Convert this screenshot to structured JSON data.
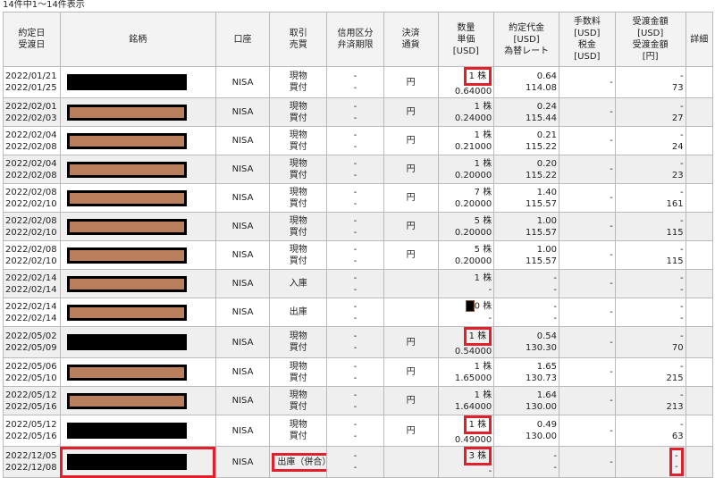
{
  "caption": "14件中1～14件表示",
  "headers": {
    "date": [
      "約定日",
      "受渡日"
    ],
    "stock": [
      "銘柄"
    ],
    "account": [
      "口座"
    ],
    "trade": [
      "取引",
      "売買"
    ],
    "credit": [
      "信用区分",
      "弁済期限"
    ],
    "settle": [
      "決済",
      "通貨"
    ],
    "qty": [
      "数量",
      "単価",
      "[USD]"
    ],
    "amount": [
      "約定代金",
      "[USD]",
      "為替レート"
    ],
    "fee": [
      "手数料",
      "[USD]",
      "税金",
      "[USD]"
    ],
    "recv": [
      "受渡金額",
      "[USD]",
      "受渡金額",
      "[円]"
    ],
    "detail": [
      "詳細"
    ]
  },
  "rows": [
    {
      "d1": "2022/01/21",
      "d2": "2022/01/25",
      "redact": "black",
      "acct": "NISA",
      "t1": "現物",
      "t2": "買付",
      "cr1": "-",
      "cr2": "-",
      "cur": "円",
      "q1": "1 株",
      "q2": "0.64000",
      "a1": "0.64",
      "a2": "114.08",
      "f1": "-",
      "f2": "",
      "r1": "-",
      "r2": "73",
      "hl_qty": true
    },
    {
      "d1": "2022/02/01",
      "d2": "2022/02/03",
      "redact": "brown",
      "acct": "NISA",
      "t1": "現物",
      "t2": "買付",
      "cr1": "-",
      "cr2": "-",
      "cur": "円",
      "q1": "1 株",
      "q2": "0.24000",
      "a1": "0.24",
      "a2": "115.44",
      "f1": "-",
      "f2": "",
      "r1": "-",
      "r2": "27"
    },
    {
      "d1": "2022/02/04",
      "d2": "2022/02/08",
      "redact": "brown",
      "acct": "NISA",
      "t1": "現物",
      "t2": "買付",
      "cr1": "-",
      "cr2": "-",
      "cur": "円",
      "q1": "1 株",
      "q2": "0.21000",
      "a1": "0.21",
      "a2": "115.22",
      "f1": "-",
      "f2": "",
      "r1": "-",
      "r2": "24"
    },
    {
      "d1": "2022/02/04",
      "d2": "2022/02/08",
      "redact": "brown",
      "acct": "NISA",
      "t1": "現物",
      "t2": "買付",
      "cr1": "-",
      "cr2": "-",
      "cur": "円",
      "q1": "1 株",
      "q2": "0.20000",
      "a1": "0.20",
      "a2": "115.22",
      "f1": "-",
      "f2": "",
      "r1": "-",
      "r2": "23"
    },
    {
      "d1": "2022/02/08",
      "d2": "2022/02/10",
      "redact": "brown",
      "acct": "NISA",
      "t1": "現物",
      "t2": "買付",
      "cr1": "-",
      "cr2": "-",
      "cur": "円",
      "q1": "7 株",
      "q2": "0.20000",
      "a1": "1.40",
      "a2": "115.57",
      "f1": "-",
      "f2": "",
      "r1": "-",
      "r2": "161"
    },
    {
      "d1": "2022/02/08",
      "d2": "2022/02/10",
      "redact": "brown",
      "acct": "NISA",
      "t1": "現物",
      "t2": "買付",
      "cr1": "-",
      "cr2": "-",
      "cur": "円",
      "q1": "5 株",
      "q2": "0.20000",
      "a1": "1.00",
      "a2": "115.57",
      "f1": "-",
      "f2": "",
      "r1": "-",
      "r2": "115"
    },
    {
      "d1": "2022/02/08",
      "d2": "2022/02/10",
      "redact": "brown",
      "acct": "NISA",
      "t1": "現物",
      "t2": "買付",
      "cr1": "-",
      "cr2": "-",
      "cur": "円",
      "q1": "5 株",
      "q2": "0.20000",
      "a1": "1.00",
      "a2": "115.57",
      "f1": "-",
      "f2": "",
      "r1": "-",
      "r2": "115"
    },
    {
      "d1": "2022/02/14",
      "d2": "2022/02/14",
      "redact": "brown",
      "acct": "NISA",
      "t1": "入庫",
      "t2": "",
      "cr1": "-",
      "cr2": "-",
      "cur": "",
      "q1": "1 株",
      "q2": "-",
      "a1": "-",
      "a2": "-",
      "f1": "-",
      "f2": "",
      "r1": "-",
      "r2": "-"
    },
    {
      "d1": "2022/02/14",
      "d2": "2022/02/14",
      "redact": "brown",
      "acct": "NISA",
      "t1": "出庫",
      "t2": "",
      "cr1": "-",
      "cr2": "-",
      "cur": "",
      "q1": "0 株",
      "q2": "-",
      "a1": "-",
      "a2": "-",
      "f1": "-",
      "f2": "",
      "r1": "-",
      "r2": "-",
      "qty_redact": true
    },
    {
      "d1": "2022/05/02",
      "d2": "2022/05/09",
      "redact": "black",
      "acct": "NISA",
      "t1": "現物",
      "t2": "買付",
      "cr1": "-",
      "cr2": "-",
      "cur": "円",
      "q1": "1 株",
      "q2": "0.54000",
      "a1": "0.54",
      "a2": "130.30",
      "f1": "-",
      "f2": "",
      "r1": "-",
      "r2": "70",
      "hl_qty": true
    },
    {
      "d1": "2022/05/06",
      "d2": "2022/05/10",
      "redact": "brown",
      "acct": "NISA",
      "t1": "現物",
      "t2": "買付",
      "cr1": "-",
      "cr2": "-",
      "cur": "円",
      "q1": "1 株",
      "q2": "1.65000",
      "a1": "1.65",
      "a2": "130.73",
      "f1": "-",
      "f2": "",
      "r1": "-",
      "r2": "215"
    },
    {
      "d1": "2022/05/12",
      "d2": "2022/05/16",
      "redact": "brown",
      "acct": "NISA",
      "t1": "現物",
      "t2": "買付",
      "cr1": "-",
      "cr2": "-",
      "cur": "円",
      "q1": "1 株",
      "q2": "1.64000",
      "a1": "1.64",
      "a2": "130.00",
      "f1": "-",
      "f2": "",
      "r1": "-",
      "r2": "213"
    },
    {
      "d1": "2022/05/12",
      "d2": "2022/05/16",
      "redact": "black",
      "acct": "NISA",
      "t1": "現物",
      "t2": "買付",
      "cr1": "-",
      "cr2": "-",
      "cur": "円",
      "q1": "1 株",
      "q2": "0.49000",
      "a1": "0.49",
      "a2": "130.00",
      "f1": "-",
      "f2": "",
      "r1": "-",
      "r2": "63",
      "hl_qty": true
    },
    {
      "d1": "2022/12/05",
      "d2": "2022/12/08",
      "redact": "black_hl",
      "acct": "NISA",
      "t1": "出庫（併合）",
      "t2": "",
      "cr1": "-",
      "cr2": "-",
      "cur": "",
      "q1": "3 株",
      "q2": "-",
      "a1": "-",
      "a2": "-",
      "f1": "-",
      "f2": "",
      "r1": "-",
      "r2": "-",
      "hl_qty": true,
      "hl_trade": true,
      "hl_recv": true
    }
  ],
  "colors": {
    "highlight": "#e0202a",
    "redact_brown": "#b97e5c",
    "row_alt": "#efefef"
  }
}
